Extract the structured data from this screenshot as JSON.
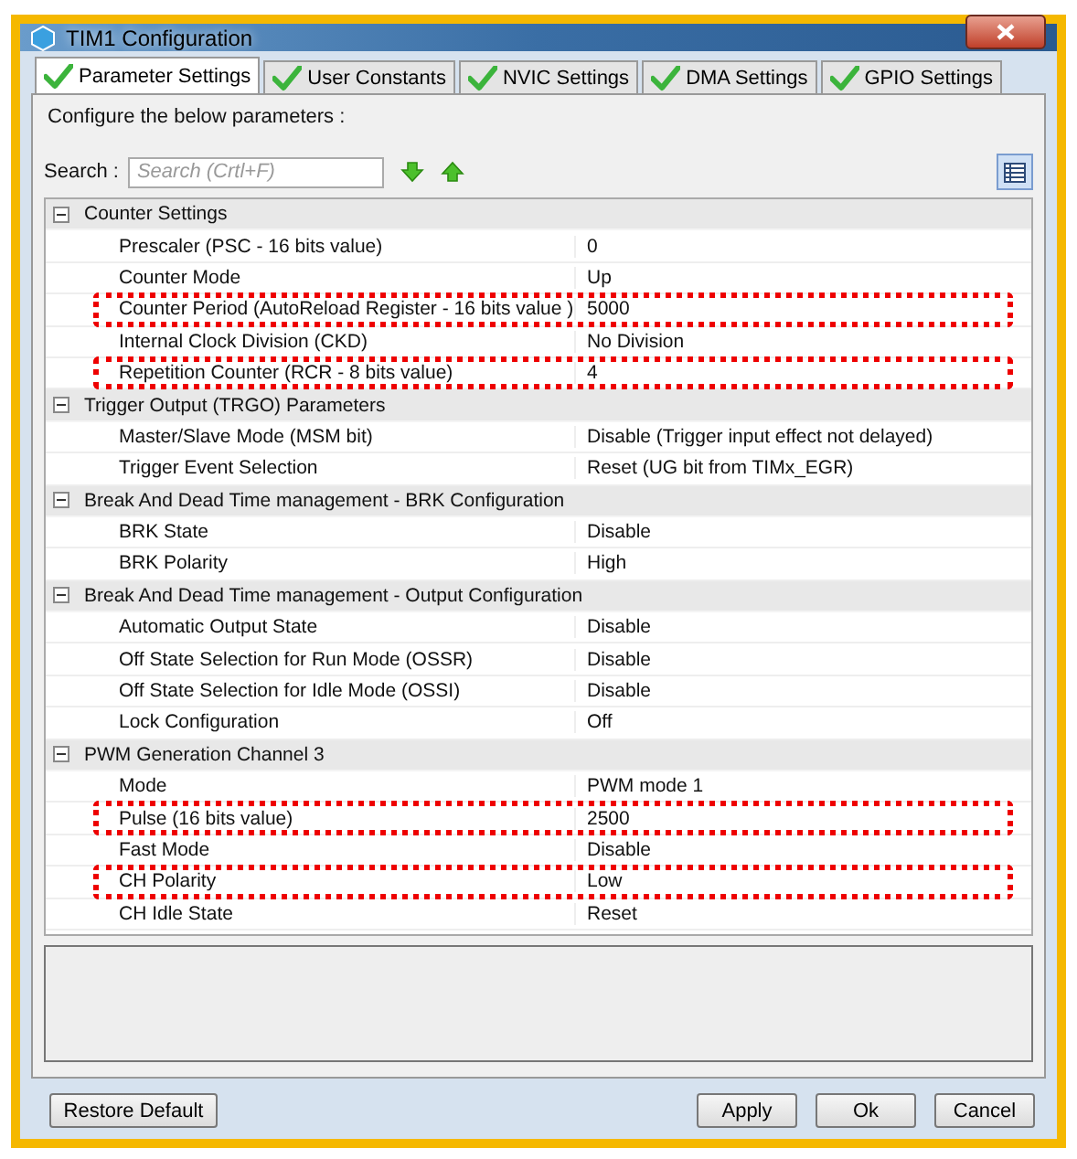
{
  "window": {
    "title": "TIM1 Configuration"
  },
  "tabs": [
    {
      "label": "Parameter Settings",
      "selected": true
    },
    {
      "label": "User Constants",
      "selected": false
    },
    {
      "label": "NVIC Settings",
      "selected": false
    },
    {
      "label": "DMA Settings",
      "selected": false
    },
    {
      "label": "GPIO Settings",
      "selected": false
    }
  ],
  "instruction": "Configure the below parameters :",
  "search": {
    "label": "Search :",
    "placeholder": "Search (Crtl+F)"
  },
  "groups": [
    {
      "title": "Counter Settings",
      "expanded": true,
      "rows": [
        {
          "name": "Prescaler (PSC - 16 bits value)",
          "value": "0",
          "highlighted": false
        },
        {
          "name": "Counter Mode",
          "value": "Up",
          "highlighted": false
        },
        {
          "name": "Counter Period (AutoReload Register - 16 bits value )",
          "value": "5000",
          "highlighted": true
        },
        {
          "name": "Internal Clock Division (CKD)",
          "value": "No Division",
          "highlighted": false
        },
        {
          "name": "Repetition Counter (RCR - 8 bits value)",
          "value": "4",
          "highlighted": true
        }
      ]
    },
    {
      "title": "Trigger Output (TRGO) Parameters",
      "expanded": true,
      "rows": [
        {
          "name": "Master/Slave Mode (MSM bit)",
          "value": "Disable (Trigger input effect not delayed)",
          "highlighted": false
        },
        {
          "name": "Trigger Event Selection",
          "value": "Reset (UG bit from TIMx_EGR)",
          "highlighted": false
        }
      ]
    },
    {
      "title": "Break And Dead Time management - BRK Configuration",
      "expanded": true,
      "rows": [
        {
          "name": "BRK State",
          "value": "Disable",
          "highlighted": false
        },
        {
          "name": "BRK Polarity",
          "value": "High",
          "highlighted": false
        }
      ]
    },
    {
      "title": "Break And Dead Time management - Output Configuration",
      "expanded": true,
      "rows": [
        {
          "name": "Automatic Output State",
          "value": "Disable",
          "highlighted": false
        },
        {
          "name": "Off State Selection for Run Mode (OSSR)",
          "value": "Disable",
          "highlighted": false
        },
        {
          "name": "Off State Selection for Idle Mode (OSSI)",
          "value": "Disable",
          "highlighted": false
        },
        {
          "name": "Lock Configuration",
          "value": "Off",
          "highlighted": false
        }
      ]
    },
    {
      "title": "PWM Generation Channel 3",
      "expanded": true,
      "rows": [
        {
          "name": "Mode",
          "value": "PWM mode 1",
          "highlighted": false
        },
        {
          "name": "Pulse (16 bits value)",
          "value": "2500",
          "highlighted": true
        },
        {
          "name": "Fast Mode",
          "value": "Disable",
          "highlighted": false
        },
        {
          "name": "CH Polarity",
          "value": "Low",
          "highlighted": true
        },
        {
          "name": "CH Idle State",
          "value": "Reset",
          "highlighted": false
        }
      ]
    }
  ],
  "buttons_left": [
    "Restore Default"
  ],
  "buttons_right": [
    "Apply",
    "Ok",
    "Cancel"
  ]
}
